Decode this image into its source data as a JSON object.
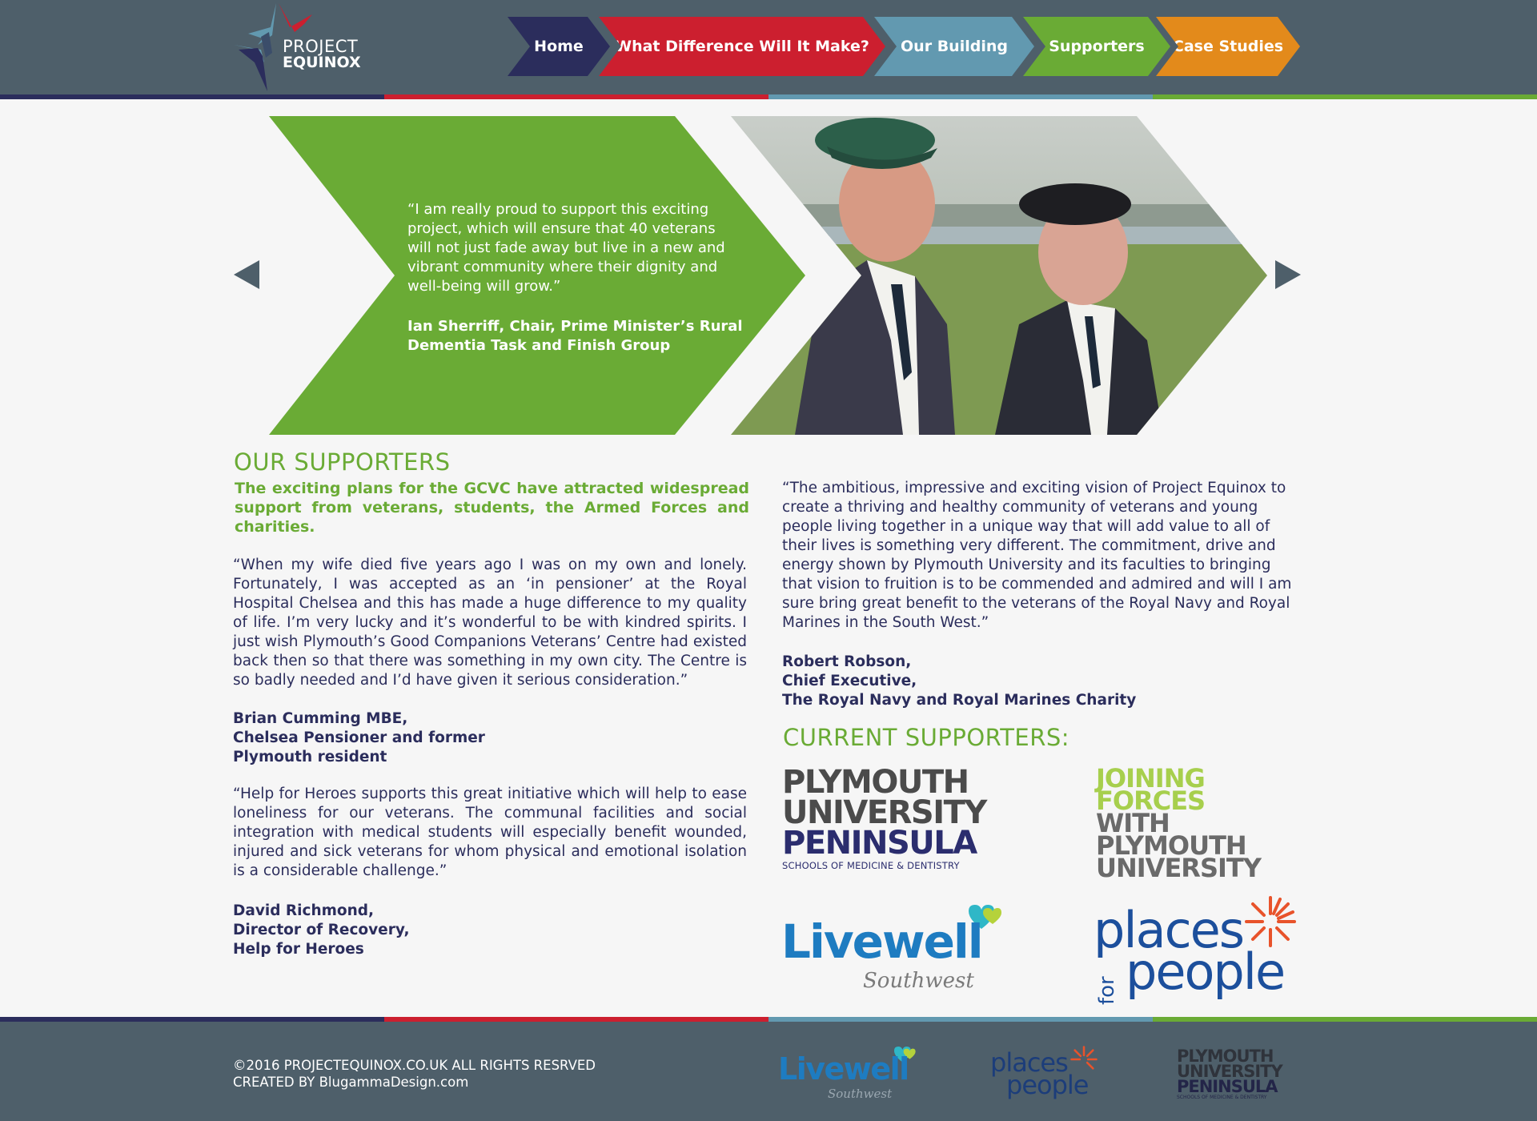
{
  "header": {
    "logo_line1": "PROJECT",
    "logo_line2": "EQUINOX",
    "nav": [
      {
        "label": "Home"
      },
      {
        "label": "What Difference Will It Make?"
      },
      {
        "label": "Our Building"
      },
      {
        "label": "Supporters"
      },
      {
        "label": "Case Studies"
      }
    ]
  },
  "hero": {
    "quote": "“I am really proud to support this exciting project, which will ensure that 40 veterans will not just fade away but live in a new and vibrant community where their dignity and well-being will grow.”",
    "author": "Ian Sherriff, Chair, Prime Minister’s Rural Dementia Task and Finish Group"
  },
  "supporters": {
    "heading": "OUR SUPPORTERS",
    "lead": "The exciting plans for the GCVC have attracted widespread support from veterans, students, the Armed Forces and charities.",
    "quotes": [
      {
        "text": "“When my wife died five years ago I was on my own and lonely. Fortunately, I was accepted as an ‘in pensioner’ at the Royal Hospital Chelsea and this has made a huge difference to my quality of life. I’m very lucky and it’s wonderful to be with kindred spirits. I just wish Plymouth’s Good Companions Veterans’ Centre had existed back then so that there was something in my own city. The Centre is so badly needed and I’d have given it serious consideration.”",
        "author_lines": [
          "Brian Cumming MBE,",
          "Chelsea Pensioner and former",
          "Plymouth resident"
        ]
      },
      {
        "text": "“Help for Heroes supports this great initiative which will help to ease loneliness for our veterans.  The communal facilities and social integration with medical students will especially benefit wounded, injured and sick veterans for whom physical and emotional isolation is a considerable challenge.”",
        "author_lines": [
          "David Richmond,",
          "Director of Recovery,",
          "Help for Heroes"
        ]
      },
      {
        "text": "“The ambitious, impressive and exciting vision of Project Equinox to create a thriving and healthy community of veterans and young people living together in a unique way that will add value to all of their lives is something very different. The commitment, drive and energy shown by Plymouth University and its faculties to bringing that vision to fruition is to be commended and admired and will I am sure bring great benefit to the veterans of the Royal Navy and Royal Marines in the South West.”",
        "author_lines": [
          "Robert Robson,",
          "Chief Executive,",
          "The Royal Navy and Royal Marines Charity"
        ]
      }
    ]
  },
  "current": {
    "heading": "CURRENT SUPPORTERS:",
    "plymouth": {
      "l1": "PLYMOUTH",
      "l2": "UNIVERSITY",
      "l3": "PENINSULA",
      "sub": "SCHOOLS OF MEDICINE & DENTISTRY"
    },
    "joining": {
      "l1": "JOINING",
      "l2": "FORCES",
      "l3": "WITH",
      "l4": "PLYMOUTH",
      "l5": "UNIVERSITY"
    },
    "livewell": {
      "word": "Livewell",
      "sub": "Southwest"
    },
    "places": {
      "places": "places",
      "for": "for",
      "people": "people"
    }
  },
  "footer": {
    "copyright": "©2016 PROJECTEQUINOX.CO.UK ALL RIGHTS RESRVED",
    "created": "CREATED BY BlugammaDesign.com"
  },
  "colors": {
    "navy": "#2b2d5c",
    "red": "#cc1f2f",
    "steel_blue": "#6299b0",
    "green": "#6aab35",
    "orange": "#e38a1b",
    "slate": "#4e5f6a"
  }
}
